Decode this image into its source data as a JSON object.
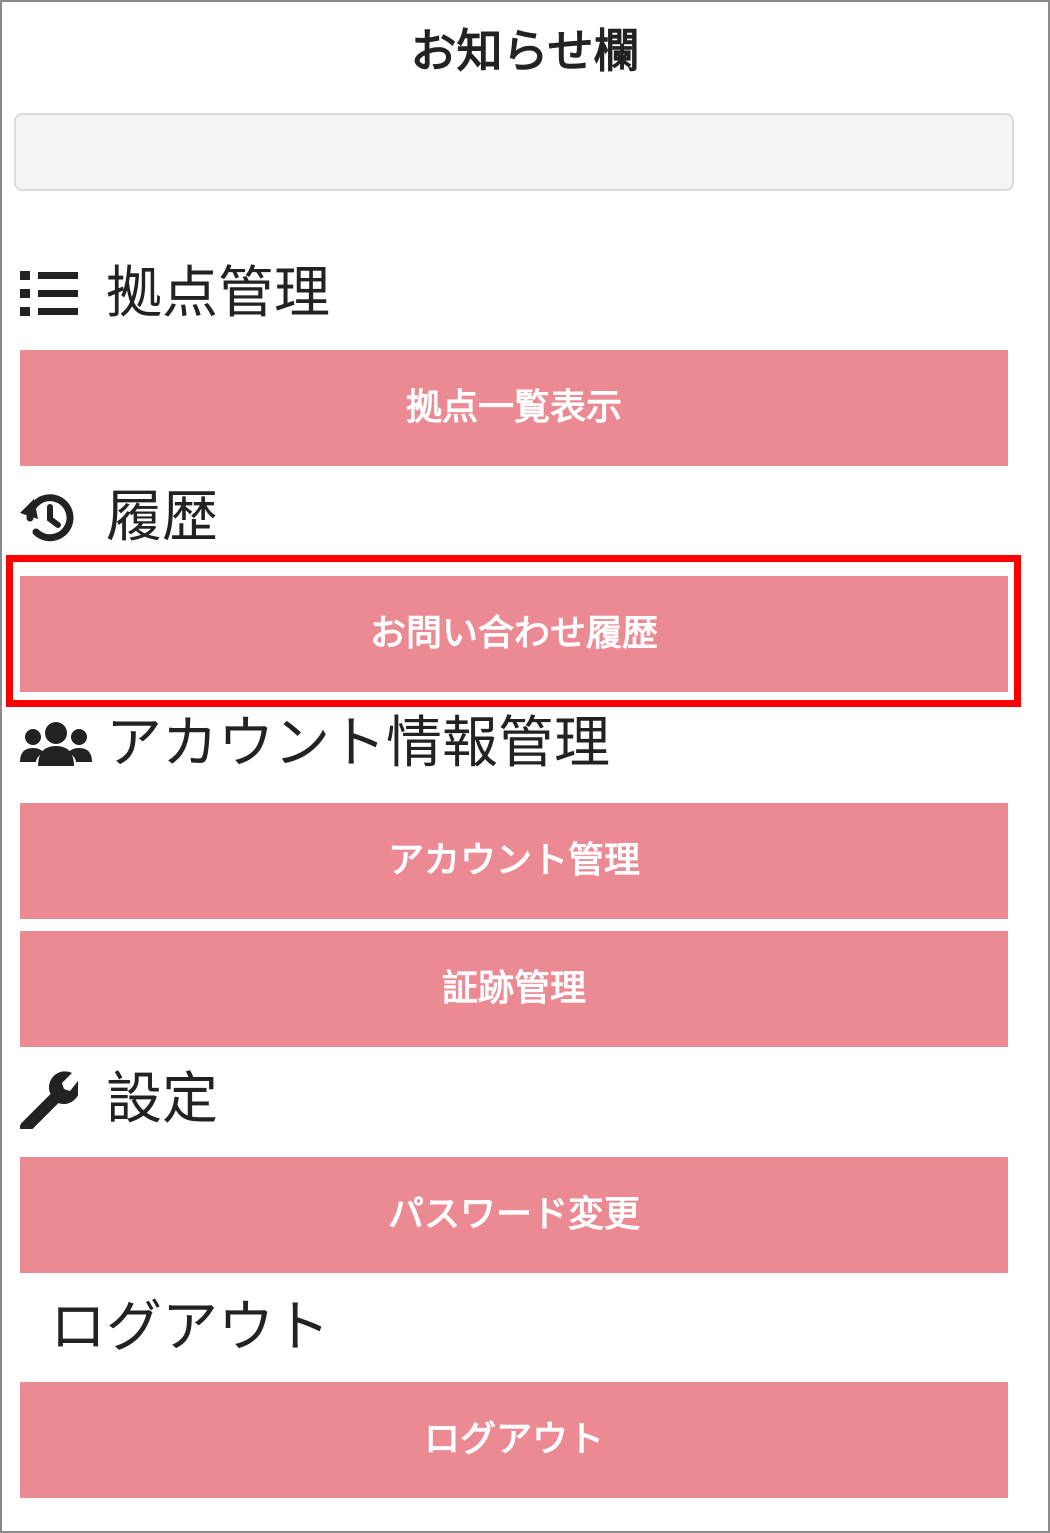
{
  "title": "お知らせ欄",
  "notice": {
    "text": ""
  },
  "sections": {
    "location": {
      "label": "拠点管理",
      "icon": "list-icon",
      "button": "拠点一覧表示"
    },
    "history": {
      "label": "履歴",
      "icon": "history-icon",
      "button": "お問い合わせ履歴"
    },
    "account": {
      "label": "アカウント情報管理",
      "icon": "users-icon",
      "buttons": [
        "アカウント管理",
        "証跡管理"
      ]
    },
    "settings": {
      "label": "設定",
      "icon": "wrench-icon",
      "button": "パスワード変更"
    },
    "logout": {
      "label": "ログアウト",
      "button": "ログアウト"
    }
  },
  "colors": {
    "button_bg": "#eb8a92",
    "button_text": "#ffffff",
    "highlight": "#ff0000",
    "text": "#222222"
  }
}
